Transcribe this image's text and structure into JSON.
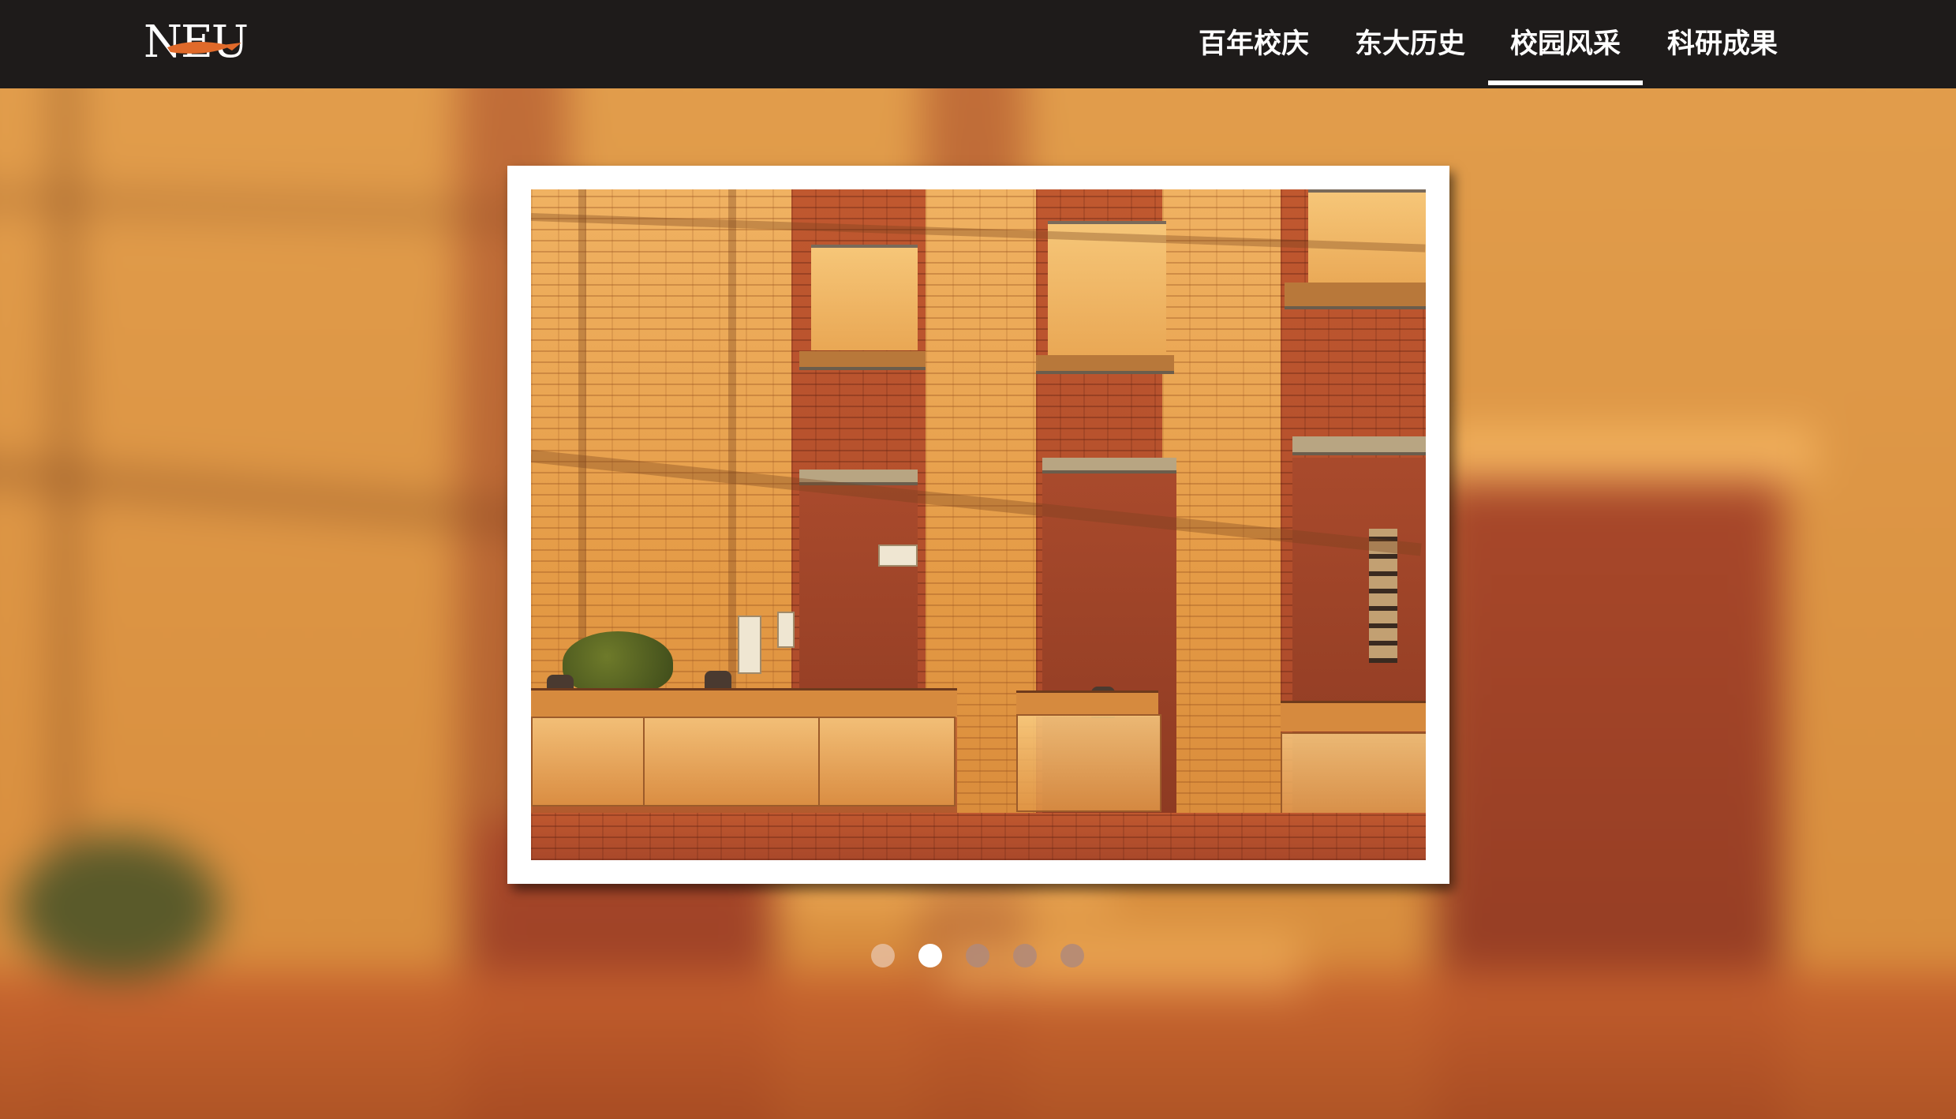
{
  "header": {
    "logo_text": "NEU",
    "logo_accent_color": "#e06a2a",
    "nav_items": [
      {
        "label": "百年校庆",
        "active": false
      },
      {
        "label": "东大历史",
        "active": false
      },
      {
        "label": "校园风采",
        "active": true
      },
      {
        "label": "科研成果",
        "active": false
      }
    ]
  },
  "carousel": {
    "current_slide": 2,
    "slide_count": 5,
    "slide_image": "campus-brick-building-photo"
  },
  "colors": {
    "navbar_bg": "#1e1b1a",
    "nav_text": "#ffffff",
    "dot_active": "#ffffff",
    "dot_inactive": "#b08a7a"
  }
}
